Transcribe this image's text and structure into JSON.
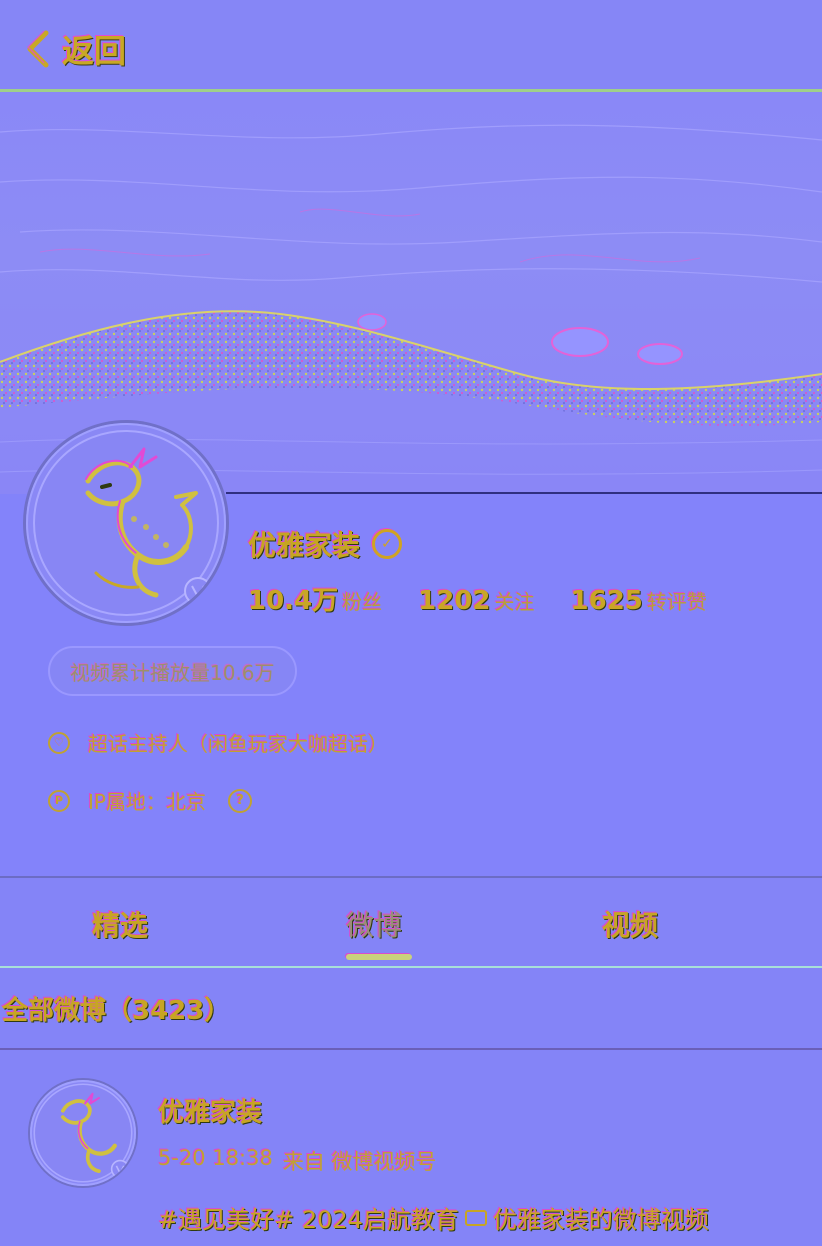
{
  "nav": {
    "back_label": "返回"
  },
  "profile": {
    "name": "优雅家装",
    "stats": [
      {
        "num": "10.4万",
        "label": "粉丝"
      },
      {
        "num": "1202",
        "label": "关注"
      },
      {
        "num": "1625",
        "label": "转评赞"
      }
    ],
    "play_count": "视频累计播放量10.6万",
    "super_topic": "超话主持人（闲鱼玩家大咖超话）",
    "ip_location": "IP属地：北京"
  },
  "tabs": [
    {
      "label": "精选"
    },
    {
      "label": "微博",
      "active": true
    },
    {
      "label": "视频"
    }
  ],
  "filter": {
    "label": "全部微博（3423）"
  },
  "post": {
    "author": "优雅家装",
    "time": "5-20 18:38",
    "source": "来自 微博视频号",
    "text_hashtag": "#遇见美好# 2024启航教育",
    "text_link": "优雅家装的微博视频"
  },
  "colors": {
    "text_accent": "#c7a524",
    "background": "#8484f7"
  }
}
